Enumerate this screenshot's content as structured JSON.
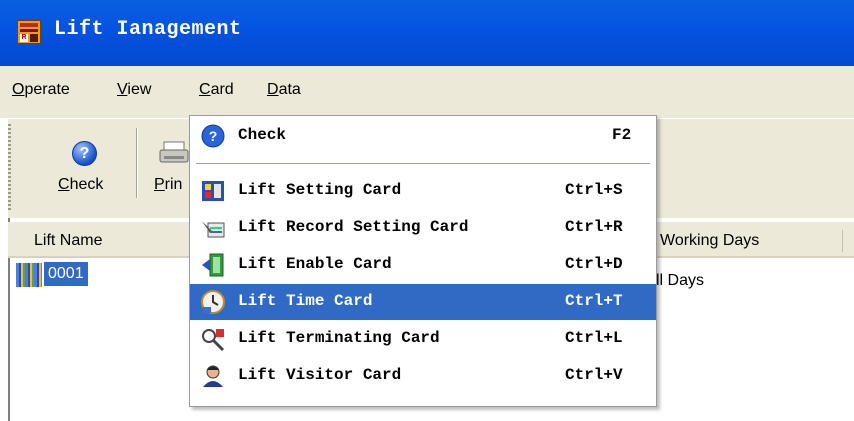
{
  "window": {
    "title": "Lift Ianagement"
  },
  "menubar": [
    {
      "label": "Operate",
      "accel": "O",
      "rest": "perate"
    },
    {
      "label": "View",
      "accel": "V",
      "rest": "iew"
    },
    {
      "label": "Card",
      "accel": "C",
      "rest": "ard"
    },
    {
      "label": "Data",
      "accel": "D",
      "rest": "ata"
    }
  ],
  "toolbar": {
    "check": {
      "accel": "C",
      "rest": "heck"
    },
    "print": {
      "accel": "P",
      "rest": "rin"
    }
  },
  "list": {
    "columns": {
      "lift_name": "Lift Name",
      "working_days": "Working Days"
    },
    "rows": [
      {
        "name": "0001",
        "days": "ll Days"
      }
    ]
  },
  "card_menu": {
    "items": [
      {
        "label": "Check",
        "shortcut": "F2",
        "icon": "help-icon"
      },
      {
        "label": "Lift Setting Card",
        "shortcut": "Ctrl+S",
        "icon": "setting-card-icon"
      },
      {
        "label": "Lift Record Setting Card",
        "shortcut": "Ctrl+R",
        "icon": "record-card-icon"
      },
      {
        "label": "Lift Enable Card",
        "shortcut": "Ctrl+D",
        "icon": "enable-card-icon"
      },
      {
        "label": "Lift Time Card",
        "shortcut": "Ctrl+T",
        "icon": "clock-card-icon",
        "highlighted": true
      },
      {
        "label": "Lift Terminating Card",
        "shortcut": "Ctrl+L",
        "icon": "terminating-card-icon"
      },
      {
        "label": "Lift Visitor Card",
        "shortcut": "Ctrl+V",
        "icon": "visitor-card-icon"
      }
    ]
  },
  "colors": {
    "titlebar": "#0553e1",
    "highlight": "#316ac5",
    "chrome": "#ece9d8"
  }
}
